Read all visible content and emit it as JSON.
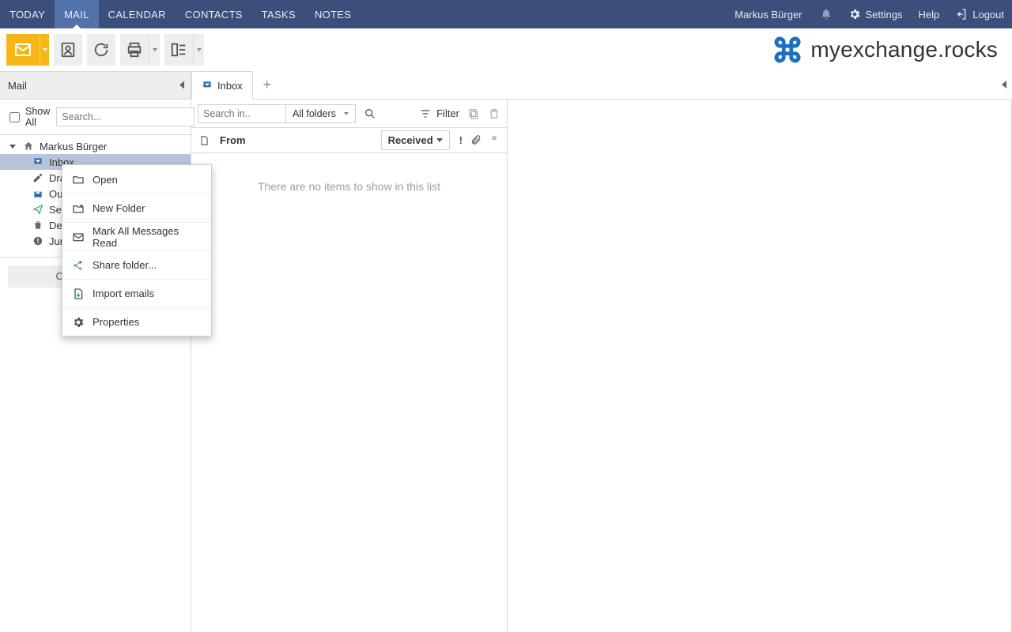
{
  "topnav": {
    "items": [
      {
        "label": "TODAY"
      },
      {
        "label": "MAIL"
      },
      {
        "label": "CALENDAR"
      },
      {
        "label": "CONTACTS"
      },
      {
        "label": "TASKS"
      },
      {
        "label": "NOTES"
      }
    ],
    "active_index": 1
  },
  "topright": {
    "user": "Markus Bürger",
    "settings": "Settings",
    "help": "Help",
    "logout": "Logout"
  },
  "brand": {
    "text": "myexchange.rocks"
  },
  "sidebar": {
    "title": "Mail",
    "show_all": "Show All",
    "search_placeholder": "Search...",
    "account_name": "Markus Bürger",
    "folders": [
      {
        "label": "Inbox",
        "selected": true
      },
      {
        "label": "Drafts"
      },
      {
        "label": "Outbox"
      },
      {
        "label": "Sent Items"
      },
      {
        "label": "Deleted Items"
      },
      {
        "label": "Junk Email"
      }
    ],
    "other_users": "Open other user..."
  },
  "tabs": {
    "items": [
      {
        "label": "Inbox"
      }
    ]
  },
  "list": {
    "search_placeholder": "Search in..",
    "scope": "All folders",
    "filter": "Filter",
    "col_from": "From",
    "col_received": "Received",
    "empty": "There are no items to show in this list"
  },
  "context_menu": {
    "items": [
      {
        "label": "Open"
      },
      {
        "label": "New Folder"
      },
      {
        "label": "Mark All Messages Read"
      },
      {
        "label": "Share folder..."
      },
      {
        "label": "Import emails"
      },
      {
        "label": "Properties"
      }
    ]
  }
}
